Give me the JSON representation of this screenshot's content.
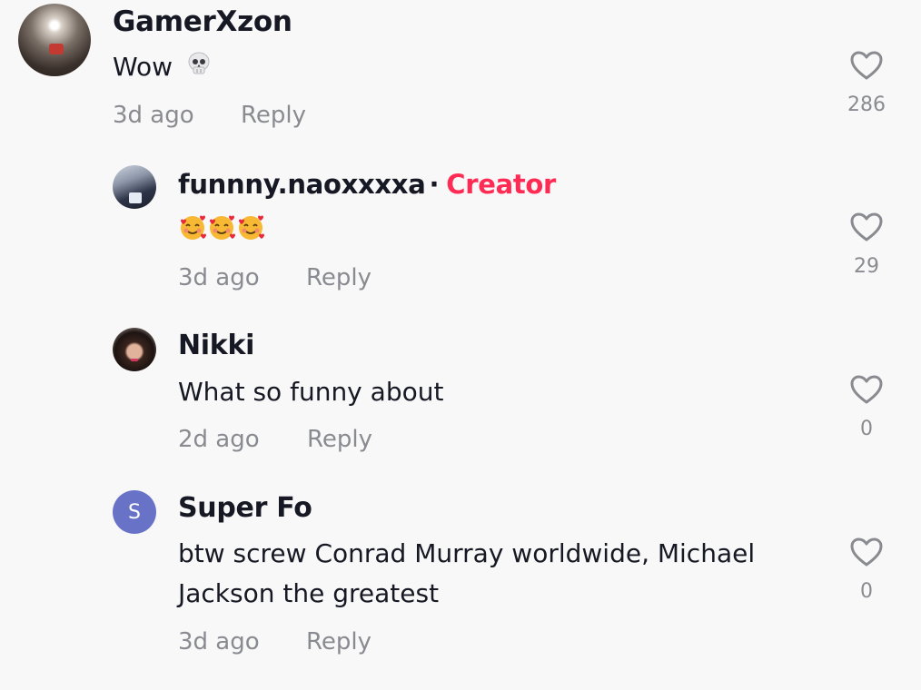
{
  "comments": [
    {
      "username": "GamerXzon",
      "text": "Wow",
      "emoji": "skull",
      "time": "3d ago",
      "reply_label": "Reply",
      "likes": "286"
    },
    {
      "username": "funnny.naoxxxxa",
      "badge_separator": "·",
      "badge": "Creator",
      "emoji": "smiling-face-with-hearts x3",
      "time": "3d ago",
      "reply_label": "Reply",
      "likes": "29"
    },
    {
      "username": "Nikki",
      "text": "What so funny about",
      "time": "2d ago",
      "reply_label": "Reply",
      "likes": "0"
    },
    {
      "username": "Super Fo",
      "avatar_letter": "S",
      "text_line1": "btw screw Conrad Murray worldwide, Michael",
      "text_line2": "Jackson the greatest",
      "time": "3d ago",
      "reply_label": "Reply",
      "likes": "0"
    }
  ],
  "colors": {
    "background": "#f8f8f8",
    "text_primary": "#161823",
    "text_secondary": "#8a8b91",
    "creator_badge": "#fe2c55",
    "letter_avatar": "#6873c8"
  },
  "icons": {
    "like": "heart-outline-icon",
    "emoji_skull": "skull-emoji-icon",
    "emoji_heart_face": "smiling-face-with-hearts-icon"
  }
}
